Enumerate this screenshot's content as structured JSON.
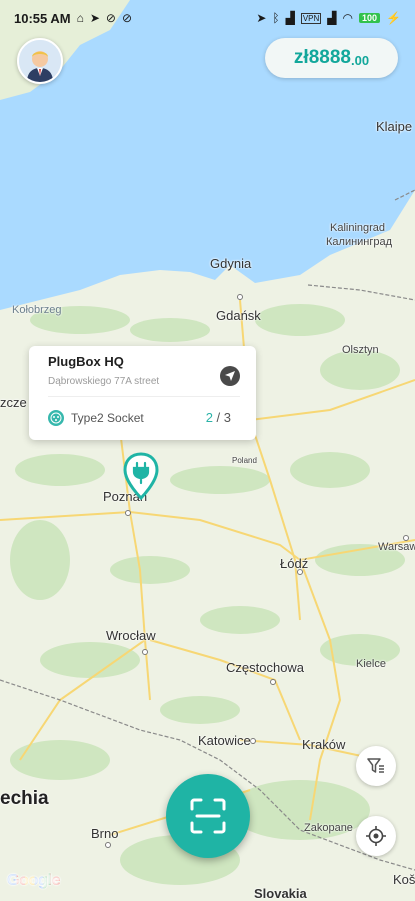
{
  "status_bar": {
    "time": "10:55 AM",
    "battery": "100"
  },
  "balance": {
    "currency": "zł",
    "amount_main": "8888",
    "amount_fraction": ".00"
  },
  "station_card": {
    "title": "PlugBox HQ",
    "address": "Dąbrowskiego 77A street",
    "socket_label": "Type2 Socket",
    "available": "2",
    "separator": " / ",
    "total": "3"
  },
  "map_labels": {
    "gdynia": "Gdynia",
    "gdansk": "Gdańsk",
    "kolobrzeg": "Kołobrzeg",
    "olsztyn": "Olsztyn",
    "kaliningrad": "Kaliningrad",
    "kaliningrad_ru": "Калининград",
    "klaipeda": "Klaipe",
    "szczecin": "zcze",
    "poland": "Poland",
    "poznan": "Poznań",
    "lodz": "Łódź",
    "warsaw": "Warsaw",
    "wroclaw": "Wrocław",
    "czestochowa": "Częstochowa",
    "kielce": "Kielce",
    "katowice": "Katowice",
    "krakow": "Kraków",
    "zakopane": "Zakopane",
    "brno": "Brno",
    "czechia": "echia",
    "slovakia": "Slovakia",
    "kosice": "Koš"
  },
  "google_logo": "Google",
  "colors": {
    "accent": "#1fb4a5",
    "water": "#aadaff",
    "land": "#eef2e4"
  }
}
